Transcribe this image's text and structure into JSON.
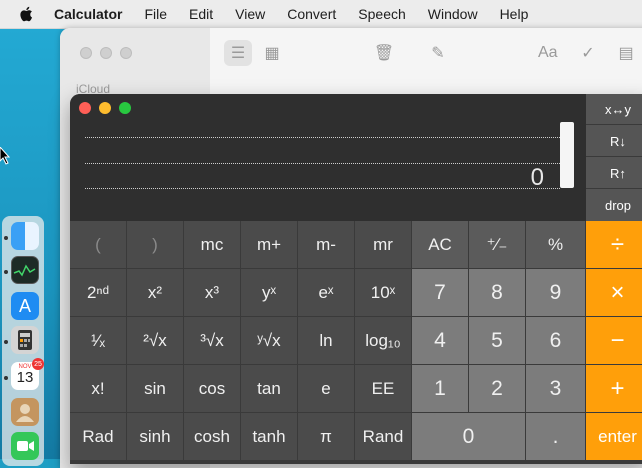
{
  "menubar": {
    "items": [
      "Calculator",
      "File",
      "Edit",
      "View",
      "Convert",
      "Speech",
      "Window",
      "Help"
    ]
  },
  "notes": {
    "sidebar_label": "iCloud",
    "font_button": "Aa"
  },
  "dock": {
    "calendar_month": "NOV",
    "calendar_day": "13",
    "calendar_badge": "25"
  },
  "calculator": {
    "display_value": "0",
    "rpn_buttons": [
      "x↔y",
      "R↓",
      "R↑",
      "drop"
    ],
    "rows": [
      [
        "(",
        ")",
        "mc",
        "m+",
        "m-",
        "mr",
        "AC",
        "⁺∕₋",
        "%",
        "÷"
      ],
      [
        "2ⁿᵈ",
        "x²",
        "x³",
        "yˣ",
        "eˣ",
        "10ˣ",
        "7",
        "8",
        "9",
        "×"
      ],
      [
        "¹⁄ₓ",
        "²√x",
        "³√x",
        "ʸ√x",
        "ln",
        "log₁₀",
        "4",
        "5",
        "6",
        "−"
      ],
      [
        "x!",
        "sin",
        "cos",
        "tan",
        "e",
        "EE",
        "1",
        "2",
        "3",
        "+"
      ],
      [
        "Rad",
        "sinh",
        "cosh",
        "tanh",
        "π",
        "Rand",
        "0",
        ".",
        "enter"
      ]
    ]
  },
  "colors": {
    "accent_orange": "#ff9f0a",
    "close": "#ff5f57",
    "minimize": "#febc2e",
    "zoom": "#28c840"
  }
}
